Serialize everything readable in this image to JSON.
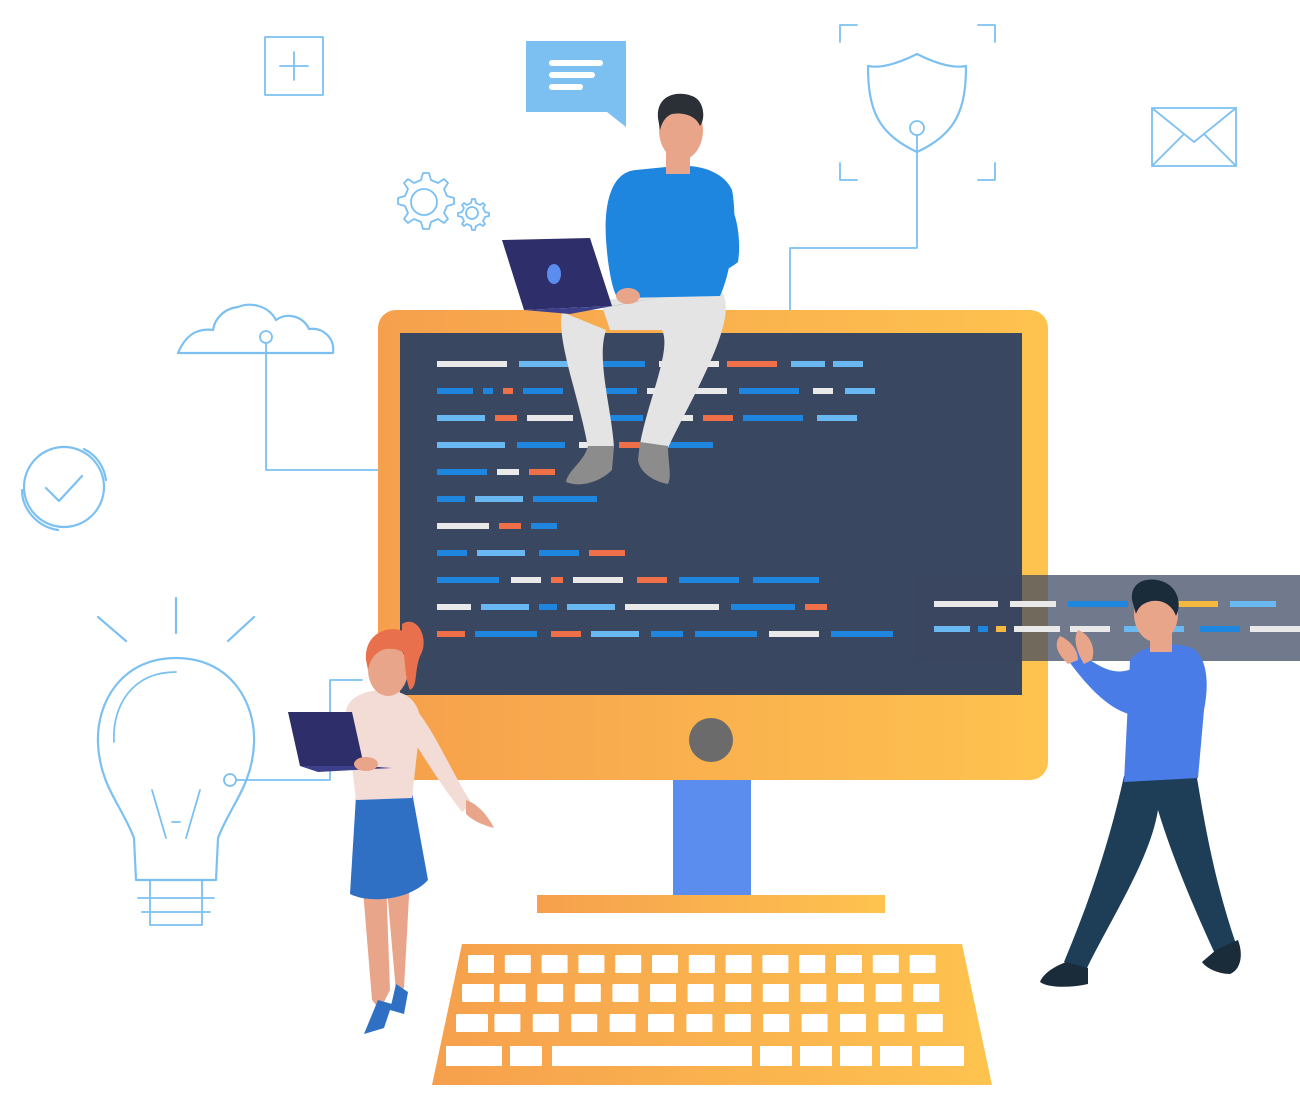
{
  "scene": {
    "description_free": true,
    "colors": {
      "monitor_gradient_start": "#f6a04d",
      "monitor_gradient_end": "#fec34f",
      "screen": "#3a4760",
      "stand": "#5b8def",
      "outline_icons": "#7cc0f2",
      "code_white": "#e9e9e9",
      "code_blue": "#1f86e0",
      "code_light_blue": "#6ab8f2",
      "code_orange": "#ef6f49",
      "code_yellow": "#f5b93f",
      "shirt_blue": "#1f86e0",
      "person_right_shirt": "#4a7ce8",
      "skirt_blue": "#2f6fc4",
      "pants_dark": "#1d3e56",
      "skin": "#e8a58a",
      "hair_dark": "#2b2f36",
      "hair_red": "#e8704c"
    },
    "icons": [
      "plus-box-icon",
      "chat-bubble-icon",
      "shield-icon",
      "envelope-icon",
      "gears-icon",
      "cloud-icon",
      "checkmark-circle-icon",
      "lightbulb-icon"
    ]
  }
}
